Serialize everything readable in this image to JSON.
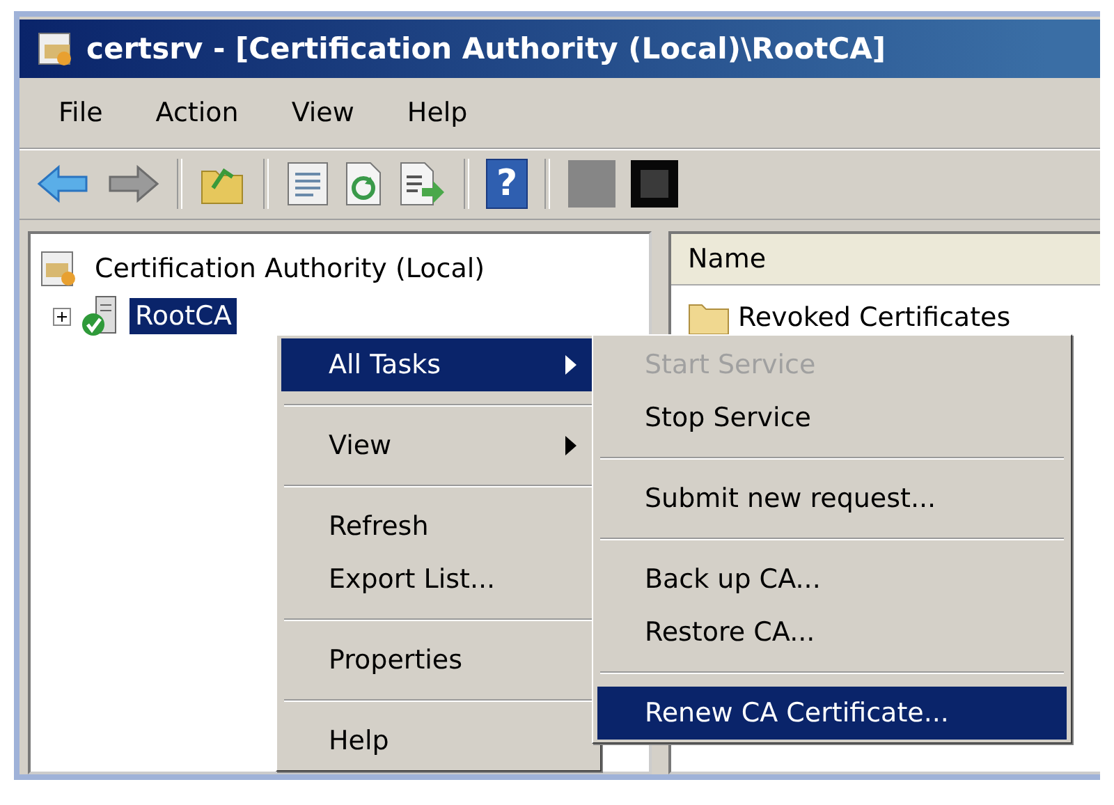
{
  "window": {
    "title": "certsrv - [Certification Authority (Local)\\RootCA]"
  },
  "menu_bar": [
    "File",
    "Action",
    "View",
    "Help"
  ],
  "toolbar": [
    {
      "kind": "back"
    },
    {
      "kind": "forward",
      "disabled": true
    },
    {
      "kind": "separator"
    },
    {
      "kind": "up-folder"
    },
    {
      "kind": "separator"
    },
    {
      "kind": "properties"
    },
    {
      "kind": "refresh"
    },
    {
      "kind": "export"
    },
    {
      "kind": "separator"
    },
    {
      "kind": "help",
      "glyph": "?"
    },
    {
      "kind": "separator"
    },
    {
      "kind": "stop-grey"
    },
    {
      "kind": "stop-black"
    }
  ],
  "tree": [
    {
      "label": "Certification Authority (Local)",
      "selected": false,
      "children": [
        {
          "label": "RootCA",
          "selected": true,
          "expanded": false
        }
      ]
    }
  ],
  "list": {
    "columns": [
      "Name"
    ],
    "rows": [
      "Revoked Certificates"
    ]
  },
  "context_menu": {
    "groups": [
      [
        {
          "label": "All Tasks",
          "submenu": true,
          "selected": true,
          "disabled": false
        }
      ],
      [
        {
          "label": "View",
          "submenu": true,
          "selected": false,
          "disabled": false
        }
      ],
      [
        {
          "label": "Refresh",
          "submenu": false,
          "selected": false,
          "disabled": false
        },
        {
          "label": "Export List...",
          "submenu": false,
          "selected": false,
          "disabled": false
        }
      ],
      [
        {
          "label": "Properties",
          "submenu": false,
          "selected": false,
          "disabled": false
        }
      ],
      [
        {
          "label": "Help",
          "submenu": false,
          "selected": false,
          "disabled": false
        }
      ]
    ]
  },
  "submenu": {
    "groups": [
      [
        {
          "label": "Start Service",
          "submenu": false,
          "selected": false,
          "disabled": true
        },
        {
          "label": "Stop Service",
          "submenu": false,
          "selected": false,
          "disabled": false
        }
      ],
      [
        {
          "label": "Submit new request...",
          "submenu": false,
          "selected": false,
          "disabled": false
        }
      ],
      [
        {
          "label": "Back up CA...",
          "submenu": false,
          "selected": false,
          "disabled": false
        },
        {
          "label": "Restore CA...",
          "submenu": false,
          "selected": false,
          "disabled": false
        }
      ],
      [
        {
          "label": "Renew CA Certificate...",
          "submenu": false,
          "selected": true,
          "disabled": false
        }
      ]
    ]
  }
}
